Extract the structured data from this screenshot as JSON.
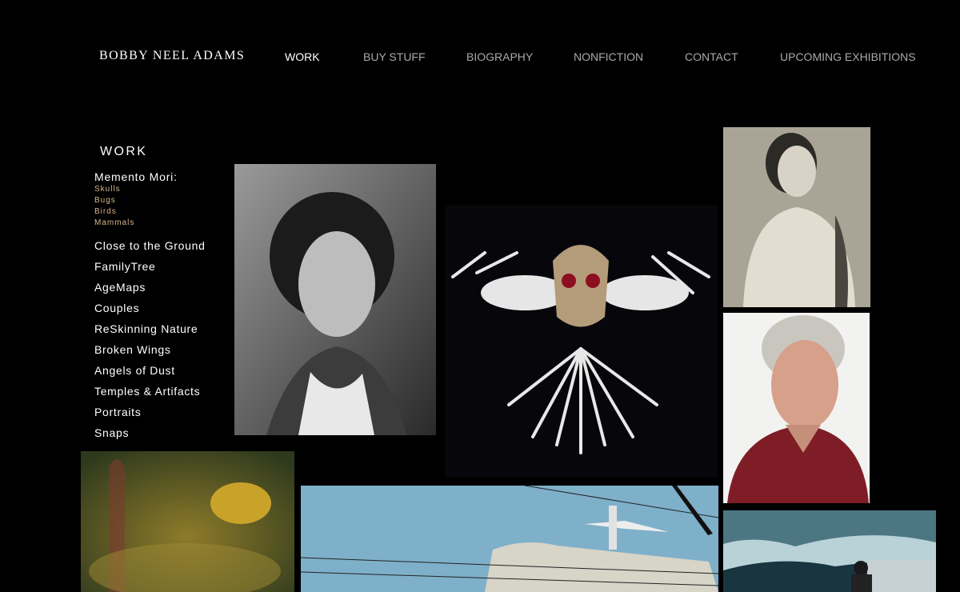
{
  "header": {
    "site_title": "BOBBY NEEL ADAMS",
    "nav": [
      {
        "label": "WORK",
        "active": true
      },
      {
        "label": "BUY STUFF"
      },
      {
        "label": "BIOGRAPHY"
      },
      {
        "label": "NONFICTION"
      },
      {
        "label": "CONTACT"
      },
      {
        "label": "UPCOMING EXHIBITIONS"
      }
    ]
  },
  "sidebar": {
    "title": "WORK",
    "memento_mori": {
      "label": "Memento Mori:",
      "items": [
        "Skulls",
        "Bugs",
        "Birds",
        "Mammals"
      ]
    },
    "series": [
      "Close to the Ground",
      "FamilyTree",
      "AgeMaps",
      "Couples",
      "ReSkinning Nature",
      "Broken Wings",
      "Angels of Dust",
      "Temples & Artifacts",
      "Portraits",
      "Snaps"
    ]
  },
  "colors": {
    "background": "#000000",
    "nav_inactive": "#a9a9a9",
    "sub_link": "#d8b48a"
  }
}
